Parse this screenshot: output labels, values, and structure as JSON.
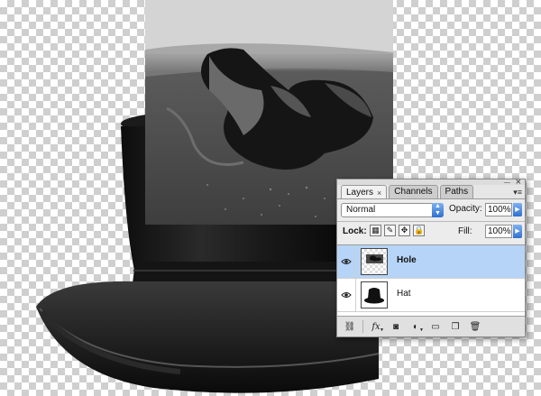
{
  "layers_panel": {
    "tabs": [
      {
        "label": "Layers",
        "active": true
      },
      {
        "label": "Channels",
        "active": false
      },
      {
        "label": "Paths",
        "active": false
      }
    ],
    "blend_mode": "Normal",
    "opacity_label": "Opacity:",
    "opacity_value": "100%",
    "lock_label": "Lock:",
    "fill_label": "Fill:",
    "fill_value": "100%",
    "layers": [
      {
        "name": "Hole",
        "visible": true,
        "selected": true
      },
      {
        "name": "Hat",
        "visible": true,
        "selected": false
      }
    ],
    "icons": {
      "lock_transparent": "checker-icon",
      "lock_image": "brush-icon",
      "lock_position": "move-icon",
      "lock_all": "lock-icon"
    },
    "bottom_buttons": [
      "link-layers",
      "add-layer-style",
      "add-layer-mask",
      "new-fill-adjustment-layer",
      "new-group",
      "new-layer",
      "delete-layer"
    ]
  },
  "colors": {
    "selection": "#b6d4f7",
    "accent": "#2f6fd0"
  }
}
